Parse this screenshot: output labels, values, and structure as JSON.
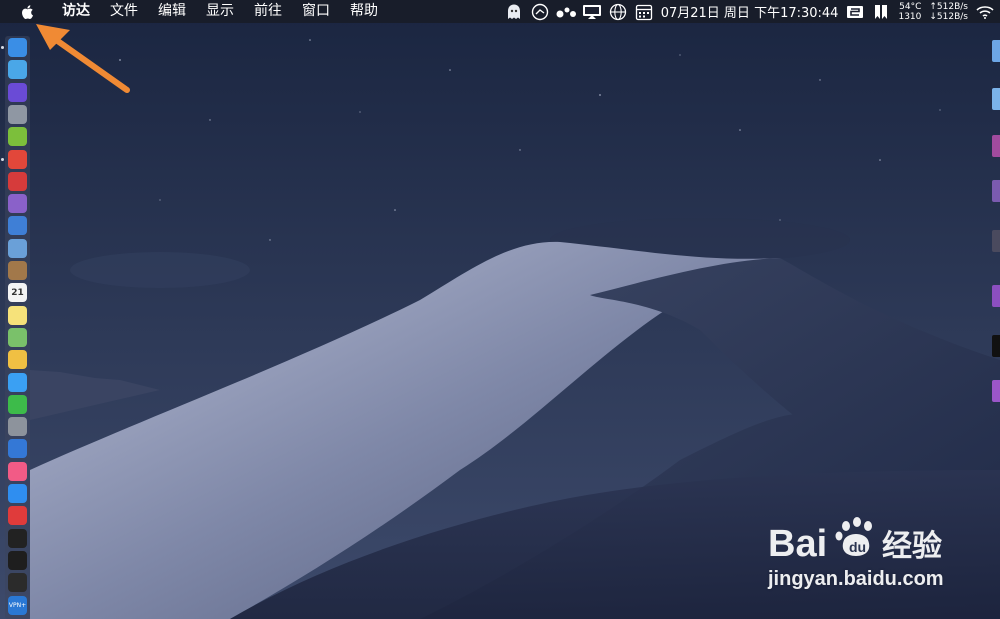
{
  "menubar": {
    "apple_icon": "apple-logo-icon",
    "app_name": "访达",
    "items": [
      "文件",
      "编辑",
      "显示",
      "前往",
      "窗口",
      "帮助"
    ],
    "tray": {
      "icons": [
        "ghost-icon",
        "share-icon",
        "dots-icon",
        "monitor-icon",
        "globe-icon",
        "calendar-icon"
      ],
      "datetime": "07月21日 周日 下午17:30:44",
      "temp": "54°C",
      "fan": "1310",
      "upload": "↑512B/s",
      "download": "↓512B/s",
      "more_icons": [
        "input-source-icon",
        "bookmark-icon",
        "wifi-icon"
      ]
    }
  },
  "dock": {
    "items": [
      {
        "name": "finder-icon",
        "color": "#3a8ee6",
        "label": ""
      },
      {
        "name": "safari-icon",
        "color": "#4aa7e8",
        "label": ""
      },
      {
        "name": "siri-icon",
        "color": "#6a4bd6",
        "label": ""
      },
      {
        "name": "launchpad-icon",
        "color": "#8f97a3",
        "label": ""
      },
      {
        "name": "android-icon",
        "color": "#7cbf3b",
        "label": ""
      },
      {
        "name": "chrome-icon",
        "color": "#e2473a",
        "label": ""
      },
      {
        "name": "app-icon",
        "color": "#d63b3b",
        "label": ""
      },
      {
        "name": "floppy-icon",
        "color": "#8a61c9",
        "label": ""
      },
      {
        "name": "compass-icon",
        "color": "#3f7fd6",
        "label": ""
      },
      {
        "name": "preview-icon",
        "color": "#6aa0d8",
        "label": ""
      },
      {
        "name": "notebook-icon",
        "color": "#a2784a",
        "label": ""
      },
      {
        "name": "calendar-icon",
        "color": "#f4f4f4",
        "label": "21"
      },
      {
        "name": "notes-icon",
        "color": "#f6e27a",
        "label": ""
      },
      {
        "name": "maps-icon",
        "color": "#7ac16a",
        "label": ""
      },
      {
        "name": "photos-icon",
        "color": "#f0c043",
        "label": ""
      },
      {
        "name": "messages-icon",
        "color": "#3aa0f3",
        "label": ""
      },
      {
        "name": "facetime-icon",
        "color": "#3dbb4a",
        "label": ""
      },
      {
        "name": "system-preferences-icon",
        "color": "#8d939c",
        "label": ""
      },
      {
        "name": "keynote-icon",
        "color": "#3478d6",
        "label": ""
      },
      {
        "name": "music-icon",
        "color": "#f25b86",
        "label": ""
      },
      {
        "name": "app-store-icon",
        "color": "#2f8ef0",
        "label": ""
      },
      {
        "name": "vivaldi-icon",
        "color": "#e03b3b",
        "label": ""
      },
      {
        "name": "terminal-icon",
        "color": "#222222",
        "label": ""
      },
      {
        "name": "activity-monitor-icon",
        "color": "#1e1e1e",
        "label": ""
      },
      {
        "name": "console-icon",
        "color": "#2b2b2b",
        "label": ""
      },
      {
        "name": "vpn-icon",
        "color": "#2a78d4",
        "label": "VPN+"
      }
    ]
  },
  "watermark": {
    "logo": "baidu-paw-icon",
    "url": "jingyan.baidu.com"
  },
  "colors": {
    "arrow": "#f08a34",
    "sky_top": "#1a2540",
    "sky_bottom": "#3d4a6b"
  }
}
